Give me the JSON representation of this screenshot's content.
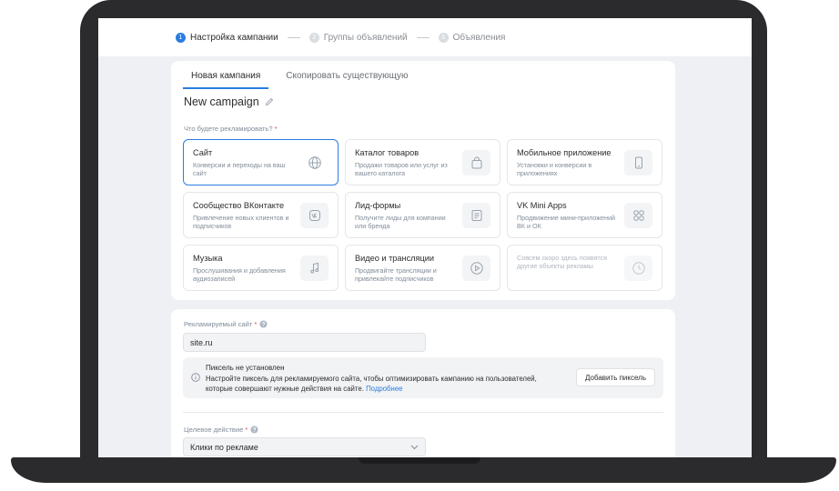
{
  "stepper": {
    "steps": [
      {
        "num": "1",
        "label": "Настройка кампании"
      },
      {
        "num": "2",
        "label": "Группы объявлений"
      },
      {
        "num": "3",
        "label": "Объявления"
      }
    ]
  },
  "tabs": {
    "new_campaign": "Новая кампания",
    "copy_existing": "Скопировать существующую"
  },
  "campaign": {
    "title": "New campaign"
  },
  "objective": {
    "question": "Что будете рекламировать?",
    "required_mark": "*",
    "options": [
      {
        "title": "Сайт",
        "desc": "Конверсии и переходы на ваш сайт",
        "icon": "globe-icon"
      },
      {
        "title": "Каталог товаров",
        "desc": "Продажи товаров или услуг из вашего каталога",
        "icon": "bag-icon"
      },
      {
        "title": "Мобильное приложение",
        "desc": "Установки и конверсии в приложениях",
        "icon": "phone-icon"
      },
      {
        "title": "Сообщество ВКонтакте",
        "desc": "Привлечение новых клиентов и подписчиков",
        "icon": "vk-icon"
      },
      {
        "title": "Лид-формы",
        "desc": "Получите лиды для компании или бренда",
        "icon": "form-icon"
      },
      {
        "title": "VK Mini Apps",
        "desc": "Продвижение мини-приложений ВК и ОК",
        "icon": "apps-icon"
      },
      {
        "title": "Музыка",
        "desc": "Прослушивания и добавления аудиозаписей",
        "icon": "music-icon"
      },
      {
        "title": "Видео и трансляции",
        "desc": "Продвигайте трансляции и привлекайте подписчиков",
        "icon": "play-icon"
      },
      {
        "title": "",
        "desc": "Совсем скоро здесь появятся другие объекты рекламы",
        "icon": "clock-icon"
      }
    ]
  },
  "site": {
    "label": "Рекламируемый сайт",
    "required_mark": "*",
    "value": "site.ru"
  },
  "pixel": {
    "title": "Пиксель не установлен",
    "text": "Настройте пиксель для рекламируемого сайта, чтобы оптимизировать кампанию на пользователей, которые совершают нужные действия на сайте.",
    "link": "Подробнее",
    "button": "Добавить пиксель"
  },
  "target_action": {
    "label": "Целевое действие",
    "required_mark": "*",
    "value": "Клики по рекламе"
  },
  "colors": {
    "accent": "#2a7de1",
    "required": "#e64646",
    "frame": "#2b2b2d",
    "screen_bg": "#eef0f3"
  }
}
